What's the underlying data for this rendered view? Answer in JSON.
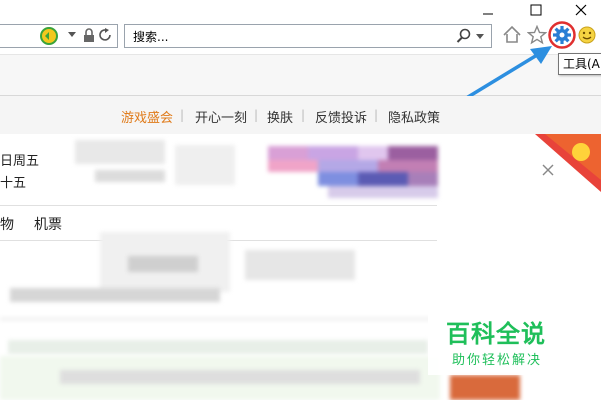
{
  "browser": {
    "search_placeholder": "搜索...",
    "tooltip": "工具(Al",
    "colors": {
      "accent_arrow": "#2d8fe0",
      "highlight_circle": "#e03030",
      "gear": "#2a7fd4"
    }
  },
  "icons": [
    "logo-360-icon",
    "dropdown-icon",
    "lock-icon",
    "refresh-icon",
    "search-icon",
    "home-icon",
    "star-icon",
    "gear-icon",
    "smiley-icon",
    "minimize-icon",
    "maximize-icon",
    "close-icon"
  ],
  "page": {
    "nav": [
      {
        "label": "游戏盛会",
        "highlight": true
      },
      {
        "label": "开心一刻"
      },
      {
        "label": "换肤"
      },
      {
        "label": "反馈投诉"
      },
      {
        "label": "隐私政策"
      }
    ],
    "date_lines": [
      "日周五",
      "十五"
    ],
    "tabs": [
      "物",
      "机票"
    ],
    "watermark": {
      "title": "百科全说",
      "subtitle": "助你轻松解决"
    }
  }
}
